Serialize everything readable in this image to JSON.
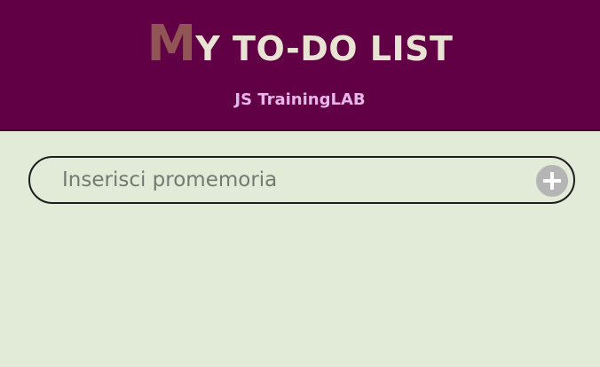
{
  "header": {
    "title_first_letter": "M",
    "title_rest": "Y TO-DO LIST",
    "subtitle": "JS TrainingLAB"
  },
  "input": {
    "placeholder": "Inserisci promemoria",
    "value": ""
  },
  "add_button": {
    "icon": "plus-icon"
  },
  "colors": {
    "header_bg": "#620046",
    "title_first_letter": "#915555",
    "title_text": "#e9e3d4",
    "subtitle": "#e6b6e6",
    "page_bg": "#e2ead8",
    "add_button_bg": "#b5b5b5"
  }
}
